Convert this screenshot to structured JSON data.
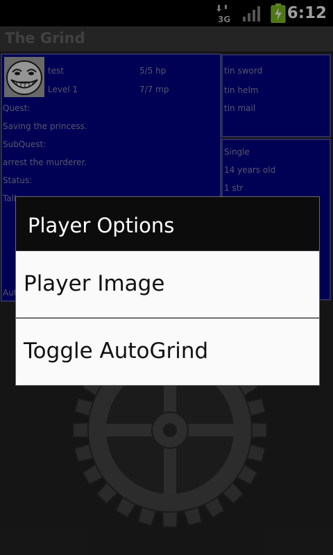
{
  "status_bar": {
    "network": "3G",
    "time": "6:12",
    "icons": [
      "3g-icon",
      "signal-icon",
      "battery-charging-icon"
    ]
  },
  "app": {
    "title": "The Grind"
  },
  "player": {
    "name": "test",
    "level": "Level 1",
    "hp": "5/5 hp",
    "mp": "7/7 mp",
    "quest_label": "Quest:",
    "quest": "Saving the princess.",
    "subquest_label": "SubQuest:",
    "subquest": "arrest the murderer.",
    "status_label": "Status:",
    "status_partial": "Tall",
    "auto_partial": "Aut"
  },
  "equipment": [
    "tin sword",
    "tin helm",
    "tin mail"
  ],
  "stats": [
    "Single",
    "14 years old",
    "1 str"
  ],
  "dialog": {
    "title": "Player Options",
    "items": [
      "Player Image",
      "Toggle AutoGrind"
    ]
  },
  "colors": {
    "panel": "#00008a",
    "panel_text": "#8e8eae",
    "dialog_item_bg": "#fafafa"
  }
}
